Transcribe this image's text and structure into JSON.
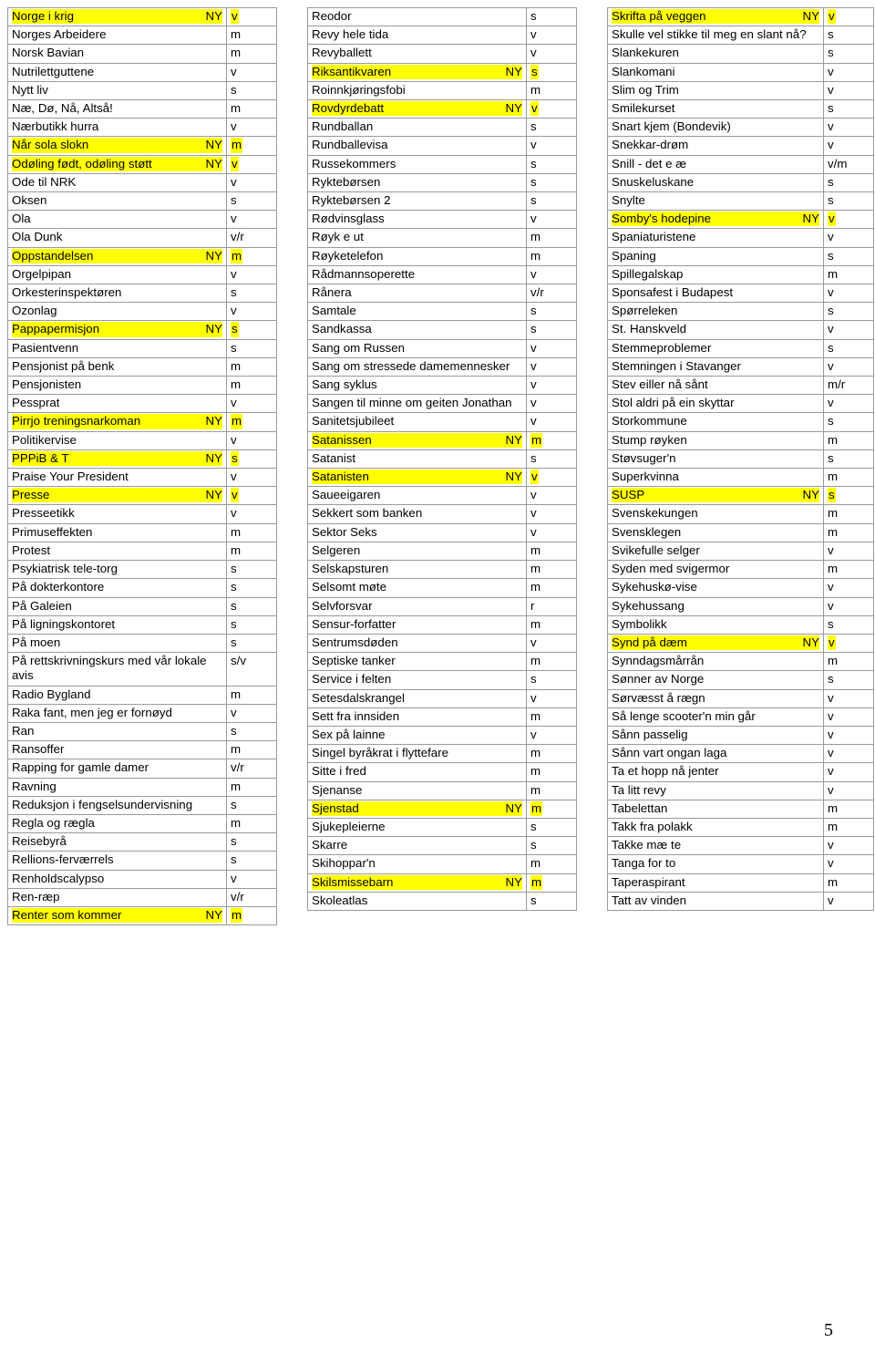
{
  "document": {
    "page_number": "5",
    "ny_tag": "NY",
    "highlight_color": "#ffff00"
  },
  "columns": [
    {
      "name": "column-left",
      "rows": [
        {
          "title": "Norge i krig",
          "ny": true,
          "code": "v"
        },
        {
          "title": "Norges Arbeidere",
          "ny": false,
          "code": "m"
        },
        {
          "title": "Norsk Bavian",
          "ny": false,
          "code": "m"
        },
        {
          "title": "Nutrilettguttene",
          "ny": false,
          "code": "v"
        },
        {
          "title": "Nytt liv",
          "ny": false,
          "code": "s"
        },
        {
          "title": "Næ, Dø, Nå, Altså!",
          "ny": false,
          "code": "m"
        },
        {
          "title": "Nærbutikk hurra",
          "ny": false,
          "code": "v"
        },
        {
          "title": "Når sola slokn",
          "ny": true,
          "code": "m"
        },
        {
          "title": "Odøling født, odøling støtt",
          "ny": true,
          "code": "v"
        },
        {
          "title": "Ode til NRK",
          "ny": false,
          "code": "v"
        },
        {
          "title": "Oksen",
          "ny": false,
          "code": "s"
        },
        {
          "title": "Ola",
          "ny": false,
          "code": "v"
        },
        {
          "title": "Ola Dunk",
          "ny": false,
          "code": "v/r"
        },
        {
          "title": "Oppstandelsen",
          "ny": true,
          "code": "m"
        },
        {
          "title": "Orgelpipan",
          "ny": false,
          "code": "v"
        },
        {
          "title": "Orkesterinspektøren",
          "ny": false,
          "code": "s"
        },
        {
          "title": "Ozonlag",
          "ny": false,
          "code": "v"
        },
        {
          "title": "Pappapermisjon",
          "ny": true,
          "code": "s"
        },
        {
          "title": "Pasientvenn",
          "ny": false,
          "code": "s"
        },
        {
          "title": "Pensjonist på benk",
          "ny": false,
          "code": "m"
        },
        {
          "title": "Pensjonisten",
          "ny": false,
          "code": "m"
        },
        {
          "title": "Pessprat",
          "ny": false,
          "code": "v"
        },
        {
          "title": "Pirrjo treningsnarkoman",
          "ny": true,
          "code": "m"
        },
        {
          "title": "Politikervise",
          "ny": false,
          "code": "v"
        },
        {
          "title": "PPPiB & T",
          "ny": true,
          "code": "s"
        },
        {
          "title": "Praise Your President",
          "ny": false,
          "code": "v"
        },
        {
          "title": "Presse",
          "ny": true,
          "code": "v"
        },
        {
          "title": "Presseetikk",
          "ny": false,
          "code": "v"
        },
        {
          "title": "Primuseffekten",
          "ny": false,
          "code": "m"
        },
        {
          "title": "Protest",
          "ny": false,
          "code": "m"
        },
        {
          "title": "Psykiatrisk tele-torg",
          "ny": false,
          "code": "s"
        },
        {
          "title": "På dokterkontore",
          "ny": false,
          "code": "s"
        },
        {
          "title": "På Galeien",
          "ny": false,
          "code": "s"
        },
        {
          "title": "På ligningskontoret",
          "ny": false,
          "code": "s"
        },
        {
          "title": "På moen",
          "ny": false,
          "code": "s"
        },
        {
          "title": "På rettskrivningskurs med vår lokale avis",
          "ny": false,
          "code": "s/v"
        },
        {
          "title": "Radio Bygland",
          "ny": false,
          "code": "m"
        },
        {
          "title": "Raka fant, men jeg er fornøyd",
          "ny": false,
          "code": "v"
        },
        {
          "title": "Ran",
          "ny": false,
          "code": "s"
        },
        {
          "title": "Ransoffer",
          "ny": false,
          "code": "m"
        },
        {
          "title": "Rapping for gamle damer",
          "ny": false,
          "code": "v/r"
        },
        {
          "title": "Ravning",
          "ny": false,
          "code": "m"
        },
        {
          "title": "Reduksjon i fengselsundervisning",
          "ny": false,
          "code": "s"
        },
        {
          "title": "Regla og rægla",
          "ny": false,
          "code": "m"
        },
        {
          "title": "Reisebyrå",
          "ny": false,
          "code": "s"
        },
        {
          "title": "Rellions-ferværrels",
          "ny": false,
          "code": "s"
        },
        {
          "title": "Renholdscalypso",
          "ny": false,
          "code": "v"
        },
        {
          "title": "Ren-ræp",
          "ny": false,
          "code": "v/r"
        },
        {
          "title": "Renter som kommer",
          "ny": true,
          "code": "m"
        }
      ]
    },
    {
      "name": "column-middle",
      "rows": [
        {
          "title": "Reodor",
          "ny": false,
          "code": "s"
        },
        {
          "title": "Revy hele tida",
          "ny": false,
          "code": "v"
        },
        {
          "title": "Revyballett",
          "ny": false,
          "code": "v"
        },
        {
          "title": "Riksantikvaren",
          "ny": true,
          "code": "s"
        },
        {
          "title": "Roinnkjøringsfobi",
          "ny": false,
          "code": "m"
        },
        {
          "title": "Rovdyrdebatt",
          "ny": true,
          "code": "v"
        },
        {
          "title": "Rundballan",
          "ny": false,
          "code": "s"
        },
        {
          "title": "Rundballevisa",
          "ny": false,
          "code": "v"
        },
        {
          "title": "Russekommers",
          "ny": false,
          "code": "s"
        },
        {
          "title": "Ryktebørsen",
          "ny": false,
          "code": "s"
        },
        {
          "title": "Ryktebørsen 2",
          "ny": false,
          "code": "s"
        },
        {
          "title": "Rødvinsglass",
          "ny": false,
          "code": "v"
        },
        {
          "title": "Røyk e ut",
          "ny": false,
          "code": "m"
        },
        {
          "title": "Røyketelefon",
          "ny": false,
          "code": "m"
        },
        {
          "title": "Rådmannsoperette",
          "ny": false,
          "code": "v"
        },
        {
          "title": "Rånera",
          "ny": false,
          "code": "v/r"
        },
        {
          "title": "Samtale",
          "ny": false,
          "code": "s"
        },
        {
          "title": "Sandkassa",
          "ny": false,
          "code": "s"
        },
        {
          "title": "Sang om Russen",
          "ny": false,
          "code": "v"
        },
        {
          "title": "Sang om stressede damemennesker",
          "ny": false,
          "code": "v"
        },
        {
          "title": "Sang syklus",
          "ny": false,
          "code": "v"
        },
        {
          "title": "Sangen til minne om geiten Jonathan",
          "ny": false,
          "code": "v"
        },
        {
          "title": "Sanitetsjubileet",
          "ny": false,
          "code": "v"
        },
        {
          "title": "Satanissen",
          "ny": true,
          "code": "m"
        },
        {
          "title": "Satanist",
          "ny": false,
          "code": "s"
        },
        {
          "title": "Satanisten",
          "ny": true,
          "code": "v"
        },
        {
          "title": "Saueeigaren",
          "ny": false,
          "code": "v"
        },
        {
          "title": "Sekkert som banken",
          "ny": false,
          "code": "v"
        },
        {
          "title": "Sektor Seks",
          "ny": false,
          "code": "v"
        },
        {
          "title": "Selgeren",
          "ny": false,
          "code": "m"
        },
        {
          "title": "Selskapsturen",
          "ny": false,
          "code": "m"
        },
        {
          "title": "Selsomt møte",
          "ny": false,
          "code": "m"
        },
        {
          "title": "Selvforsvar",
          "ny": false,
          "code": "r"
        },
        {
          "title": "Sensur-forfatter",
          "ny": false,
          "code": "m"
        },
        {
          "title": "Sentrumsdøden",
          "ny": false,
          "code": "v"
        },
        {
          "title": "Septiske tanker",
          "ny": false,
          "code": "m"
        },
        {
          "title": "Service i felten",
          "ny": false,
          "code": "s"
        },
        {
          "title": "Setesdalskrangel",
          "ny": false,
          "code": "v"
        },
        {
          "title": "Sett fra innsiden",
          "ny": false,
          "code": "m"
        },
        {
          "title": "Sex på lainne",
          "ny": false,
          "code": "v"
        },
        {
          "title": "Singel byråkrat i flyttefare",
          "ny": false,
          "code": "m"
        },
        {
          "title": "Sitte i fred",
          "ny": false,
          "code": "m"
        },
        {
          "title": "Sjenanse",
          "ny": false,
          "code": "m"
        },
        {
          "title": "Sjenstad",
          "ny": true,
          "code": "m"
        },
        {
          "title": "Sjukepleierne",
          "ny": false,
          "code": "s"
        },
        {
          "title": "Skarre",
          "ny": false,
          "code": "s"
        },
        {
          "title": "Skihoppar'n",
          "ny": false,
          "code": "m"
        },
        {
          "title": "Skilsmissebarn",
          "ny": true,
          "code": "m"
        },
        {
          "title": "Skoleatlas",
          "ny": false,
          "code": "s"
        }
      ]
    },
    {
      "name": "column-right",
      "rows": [
        {
          "title": "Skrifta på veggen",
          "ny": true,
          "code": "v"
        },
        {
          "title": "Skulle vel stikke til meg en slant nå?",
          "ny": false,
          "code": "s"
        },
        {
          "title": "Slankekuren",
          "ny": false,
          "code": "s"
        },
        {
          "title": "Slankomani",
          "ny": false,
          "code": "v"
        },
        {
          "title": "Slim og Trim",
          "ny": false,
          "code": "v"
        },
        {
          "title": "Smilekurset",
          "ny": false,
          "code": "s"
        },
        {
          "title": "Snart kjem (Bondevik)",
          "ny": false,
          "code": "v"
        },
        {
          "title": "Snekkar-drøm",
          "ny": false,
          "code": "v"
        },
        {
          "title": "Snill - det e æ",
          "ny": false,
          "code": "v/m"
        },
        {
          "title": "Snuskeluskane",
          "ny": false,
          "code": "s"
        },
        {
          "title": "Snylte",
          "ny": false,
          "code": "s"
        },
        {
          "title": "Somby's hodepine",
          "ny": true,
          "code": "v"
        },
        {
          "title": "Spaniaturistene",
          "ny": false,
          "code": "v"
        },
        {
          "title": "Spaning",
          "ny": false,
          "code": "s"
        },
        {
          "title": "Spillegalskap",
          "ny": false,
          "code": "m"
        },
        {
          "title": "Sponsafest i Budapest",
          "ny": false,
          "code": "v"
        },
        {
          "title": "Spørreleken",
          "ny": false,
          "code": "s"
        },
        {
          "title": "St. Hanskveld",
          "ny": false,
          "code": "v"
        },
        {
          "title": "Stemmeproblemer",
          "ny": false,
          "code": "s"
        },
        {
          "title": "Stemningen i Stavanger",
          "ny": false,
          "code": "v"
        },
        {
          "title": "Stev eiller nå sånt",
          "ny": false,
          "code": "m/r"
        },
        {
          "title": "Stol aldri på ein skyttar",
          "ny": false,
          "code": "v"
        },
        {
          "title": "Storkommune",
          "ny": false,
          "code": "s"
        },
        {
          "title": "Stump røyken",
          "ny": false,
          "code": "m"
        },
        {
          "title": "Støvsuger'n",
          "ny": false,
          "code": "s"
        },
        {
          "title": "Superkvinna",
          "ny": false,
          "code": "m"
        },
        {
          "title": "SUSP",
          "ny": true,
          "code": "s"
        },
        {
          "title": "Svenskekungen",
          "ny": false,
          "code": "m"
        },
        {
          "title": "Svensklegen",
          "ny": false,
          "code": "m"
        },
        {
          "title": "Svikefulle selger",
          "ny": false,
          "code": "v"
        },
        {
          "title": "Syden med svigermor",
          "ny": false,
          "code": "m"
        },
        {
          "title": "Sykehuskø-vise",
          "ny": false,
          "code": "v"
        },
        {
          "title": "Sykehussang",
          "ny": false,
          "code": "v"
        },
        {
          "title": "Symbolikk",
          "ny": false,
          "code": "s"
        },
        {
          "title": "Synd på dæm",
          "ny": true,
          "code": "v"
        },
        {
          "title": "Synndagsmårrån",
          "ny": false,
          "code": "m"
        },
        {
          "title": "Sønner av Norge",
          "ny": false,
          "code": "s"
        },
        {
          "title": "Sørvæsst å rægn",
          "ny": false,
          "code": "v"
        },
        {
          "title": "Så lenge scooter'n min går",
          "ny": false,
          "code": "v"
        },
        {
          "title": "Sånn passelig",
          "ny": false,
          "code": "v"
        },
        {
          "title": "Sånn vart ongan laga",
          "ny": false,
          "code": "v"
        },
        {
          "title": "Ta et hopp nå jenter",
          "ny": false,
          "code": "v"
        },
        {
          "title": "Ta litt revy",
          "ny": false,
          "code": "v"
        },
        {
          "title": "Tabelettan",
          "ny": false,
          "code": "m"
        },
        {
          "title": "Takk fra polakk",
          "ny": false,
          "code": "m"
        },
        {
          "title": "Takke mæ te",
          "ny": false,
          "code": "v"
        },
        {
          "title": "Tanga for to",
          "ny": false,
          "code": "v"
        },
        {
          "title": "Taperaspirant",
          "ny": false,
          "code": "m"
        },
        {
          "title": "Tatt av vinden",
          "ny": false,
          "code": "v"
        }
      ]
    }
  ]
}
